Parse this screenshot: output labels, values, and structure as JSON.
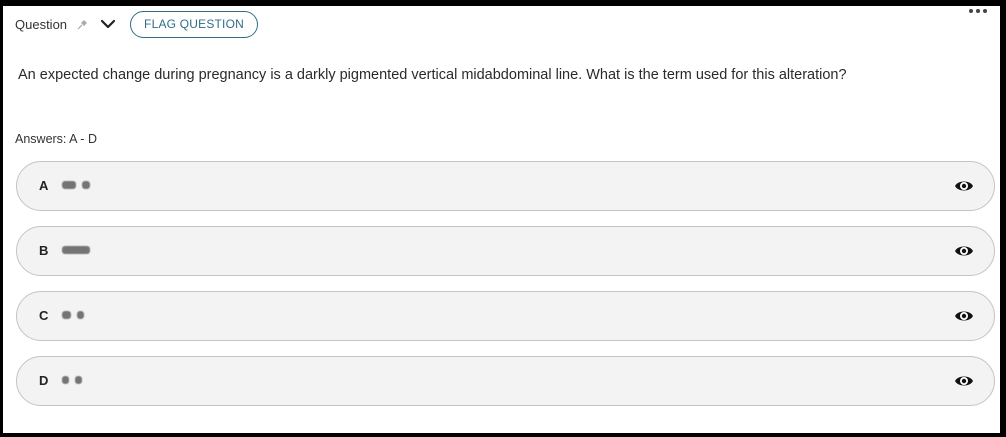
{
  "header": {
    "question_label": "Question",
    "pin_icon": "pin-icon",
    "chevron_icon": "chevron-down-icon",
    "flag_label": "FLAG QUESTION",
    "more_icon": "more-horizontal-icon"
  },
  "question": {
    "text": "An expected change during pregnancy is a darkly pigmented vertical midabdominal line. What is the term used for this alteration?"
  },
  "answers_label": "Answers: A - D",
  "options": [
    {
      "letter": "A",
      "icon": "eye-icon"
    },
    {
      "letter": "B",
      "icon": "eye-icon"
    },
    {
      "letter": "C",
      "icon": "eye-icon"
    },
    {
      "letter": "D",
      "icon": "eye-icon"
    }
  ],
  "colors": {
    "accent": "#2f6e86",
    "option_bg": "#f3f3f3",
    "option_border": "#c4c4c4"
  }
}
